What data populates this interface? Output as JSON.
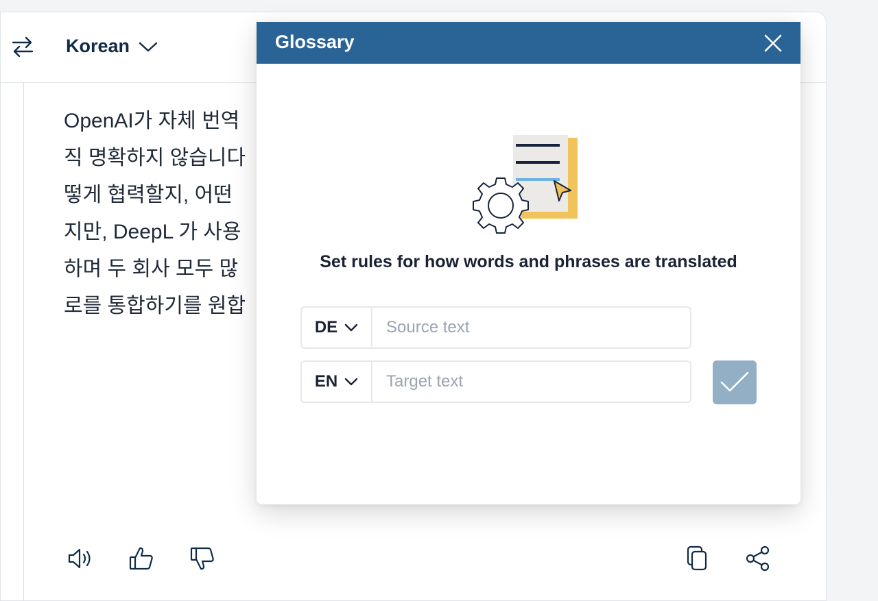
{
  "header": {
    "swap_icon": "swap-arrows-icon",
    "target_language": "Korean"
  },
  "translation": {
    "lines": [
      "OpenAI가 자체 번역",
      "직 명확하지 않습니다",
      "떻게 협력할지, 어떤",
      "지만, DeepL 가 사용",
      "하며 두 회사 모두 많",
      "로를 통합하기를 원합"
    ]
  },
  "toolbar": {
    "left_icons": [
      "speaker-icon",
      "thumbs-up-icon",
      "thumbs-down-icon"
    ],
    "right_icons": [
      "copy-icon",
      "share-icon"
    ]
  },
  "glossary": {
    "title": "Glossary",
    "close_icon": "close-icon",
    "description": "Set rules for how words and phrases are translated",
    "source_lang": "DE",
    "source_placeholder": "Source text",
    "target_lang": "EN",
    "target_placeholder": "Target text",
    "confirm_icon": "checkmark-icon"
  },
  "colors": {
    "modal_header": "#2a6496",
    "confirm_button_disabled": "#93afc6",
    "brand_dark": "#0f2b46"
  }
}
